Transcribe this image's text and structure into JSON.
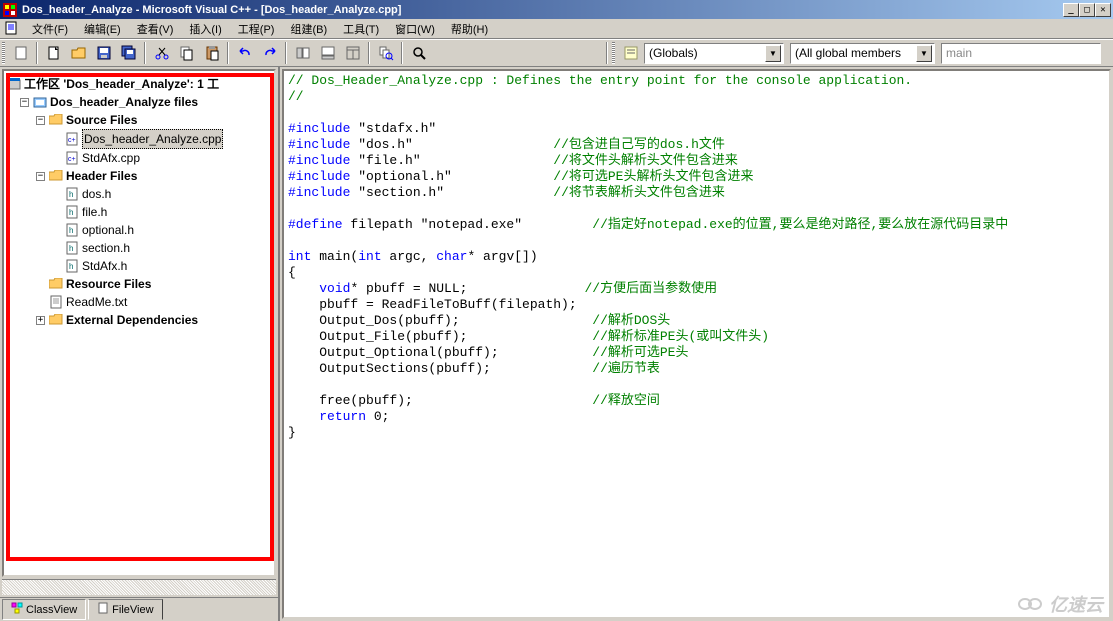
{
  "title": "Dos_header_Analyze - Microsoft Visual C++ - [Dos_header_Analyze.cpp]",
  "menus": {
    "file": "文件(F)",
    "edit": "编辑(E)",
    "view": "查看(V)",
    "insert": "插入(I)",
    "project": "工程(P)",
    "build": "组建(B)",
    "tools": "工具(T)",
    "window": "窗口(W)",
    "help": "帮助(H)"
  },
  "combos": {
    "globals": "(Globals)",
    "members": "(All global members",
    "func": "main"
  },
  "tree": {
    "workspace": "工作区 'Dos_header_Analyze': 1 工",
    "project": "Dos_header_Analyze files",
    "source_folder": "Source Files",
    "src1": "Dos_header_Analyze.cpp",
    "src2": "StdAfx.cpp",
    "header_folder": "Header Files",
    "h1": "dos.h",
    "h2": "file.h",
    "h3": "optional.h",
    "h4": "section.h",
    "h5": "StdAfx.h",
    "resource_folder": "Resource Files",
    "readme": "ReadMe.txt",
    "external": "External Dependencies"
  },
  "tabs": {
    "classview": "ClassView",
    "fileview": "FileView"
  },
  "code": {
    "l1a": "// Dos_Header_Analyze.cpp : Defines the entry point for the console application.",
    "l2": "//",
    "l4a": "#include",
    "l4b": " \"stdafx.h\"",
    "l5a": "#include",
    "l5b": " \"dos.h\"",
    "l5c": "//包含进自己写的dos.h文件",
    "l6a": "#include",
    "l6b": " \"file.h\"",
    "l6c": "//将文件头解析头文件包含进来",
    "l7a": "#include",
    "l7b": " \"optional.h\"",
    "l7c": "//将可选PE头解析头文件包含进来",
    "l8a": "#include",
    "l8b": " \"section.h\"",
    "l8c": "//将节表解析头文件包含进来",
    "l10a": "#define",
    "l10b": " filepath \"notepad.exe\"",
    "l10c": "//指定好notepad.exe的位置,要么是绝对路径,要么放在源代码目录中",
    "l12a": "int",
    "l12b": " main(",
    "l12c": "int",
    "l12d": " argc, ",
    "l12e": "char",
    "l12f": "* argv[])",
    "l13": "{",
    "l14a": "void",
    "l14b": "* pbuff = NULL;",
    "l14c": "//方便后面当参数使用",
    "l15": "pbuff = ReadFileToBuff(filepath);",
    "l16a": "Output_Dos(pbuff);",
    "l16c": "//解析DOS头",
    "l17a": "Output_File(pbuff);",
    "l17c": "//解析标准PE头(或叫文件头)",
    "l18a": "Output_Optional(pbuff);",
    "l18c": "//解析可选PE头",
    "l19a": "OutputSections(pbuff);",
    "l19c": "//遍历节表",
    "l21a": "free(pbuff);",
    "l21c": "//释放空间",
    "l22a": "return",
    "l22b": " 0;",
    "l23": "}"
  },
  "watermark": "亿速云"
}
